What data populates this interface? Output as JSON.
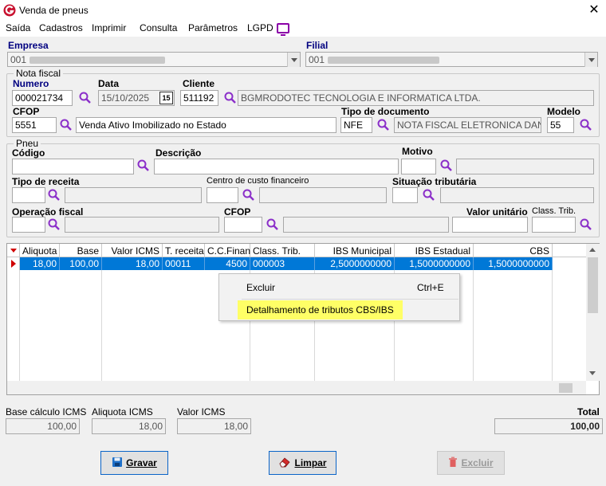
{
  "window": {
    "title": "Venda de pneus",
    "close": "✕"
  },
  "menu": {
    "items": [
      "Saída",
      "Cadastros",
      "Imprimir",
      "Consulta",
      "Parâmetros",
      "LGPD"
    ]
  },
  "empresa": {
    "label": "Empresa",
    "value": "001"
  },
  "filial": {
    "label": "Filial",
    "value": "001"
  },
  "nota": {
    "group": "Nota fiscal",
    "numero_label": "Numero",
    "numero": "000021734",
    "data_label": "Data",
    "data": "15/10/2025",
    "cal_day": "15",
    "cliente_label": "Cliente",
    "cliente_code": "511192",
    "cliente_name": "BGMRODOTEC TECNOLOGIA E INFORMATICA LTDA.",
    "cfop_label": "CFOP",
    "cfop_code": "5551",
    "cfop_desc": "Venda Ativo Imobilizado no Estado",
    "tipo_doc_label": "Tipo de documento",
    "tipo_doc_code": "NFE",
    "tipo_doc_desc": "NOTA FISCAL ELETRONICA DANFE",
    "modelo_label": "Modelo",
    "modelo": "55"
  },
  "pneu": {
    "group": "Pneu",
    "codigo_label": "Código",
    "descricao_label": "Descrição",
    "motivo_label": "Motivo",
    "tipo_receita_label": "Tipo de receita",
    "centro_custo_label": "Centro de custo financeiro",
    "situacao_label": "Situação tributária",
    "operacao_label": "Operação fiscal",
    "cfop_label": "CFOP",
    "valor_unit_label": "Valor unitário",
    "class_trib_label": "Class. Trib."
  },
  "grid": {
    "columns": [
      "Aliquota",
      "Base",
      "Valor ICMS",
      "T. receita",
      "C.C.Finan",
      "Class. Trib.",
      "IBS Municipal",
      "IBS Estadual",
      "CBS"
    ],
    "rows": [
      [
        "18,00",
        "100,00",
        "18,00",
        "00011",
        "4500",
        "000003",
        "2,5000000000",
        "1,5000000000",
        "1,5000000000"
      ]
    ]
  },
  "context_menu": {
    "items": [
      {
        "label": "Excluir",
        "shortcut": "Ctrl+E"
      },
      {
        "label": "Detalhamento de tributos CBS/IBS",
        "shortcut": ""
      }
    ],
    "highlight_color": "#ffff66"
  },
  "totals": {
    "base_label": "Base cálculo ICMS",
    "base": "100,00",
    "aliquota_label": "Aliquota ICMS",
    "aliquota": "18,00",
    "valor_label": "Valor ICMS",
    "valor": "18,00",
    "total_label": "Total",
    "total": "100,00"
  },
  "buttons": {
    "gravar": "Gravar",
    "limpar": "Limpar",
    "excluir": "Excluir"
  },
  "colors": {
    "selection": "#0078d7",
    "label_blue": "#000080",
    "search_icon": "#8b2fc9",
    "lgpd_icon": "#8b00a8"
  }
}
